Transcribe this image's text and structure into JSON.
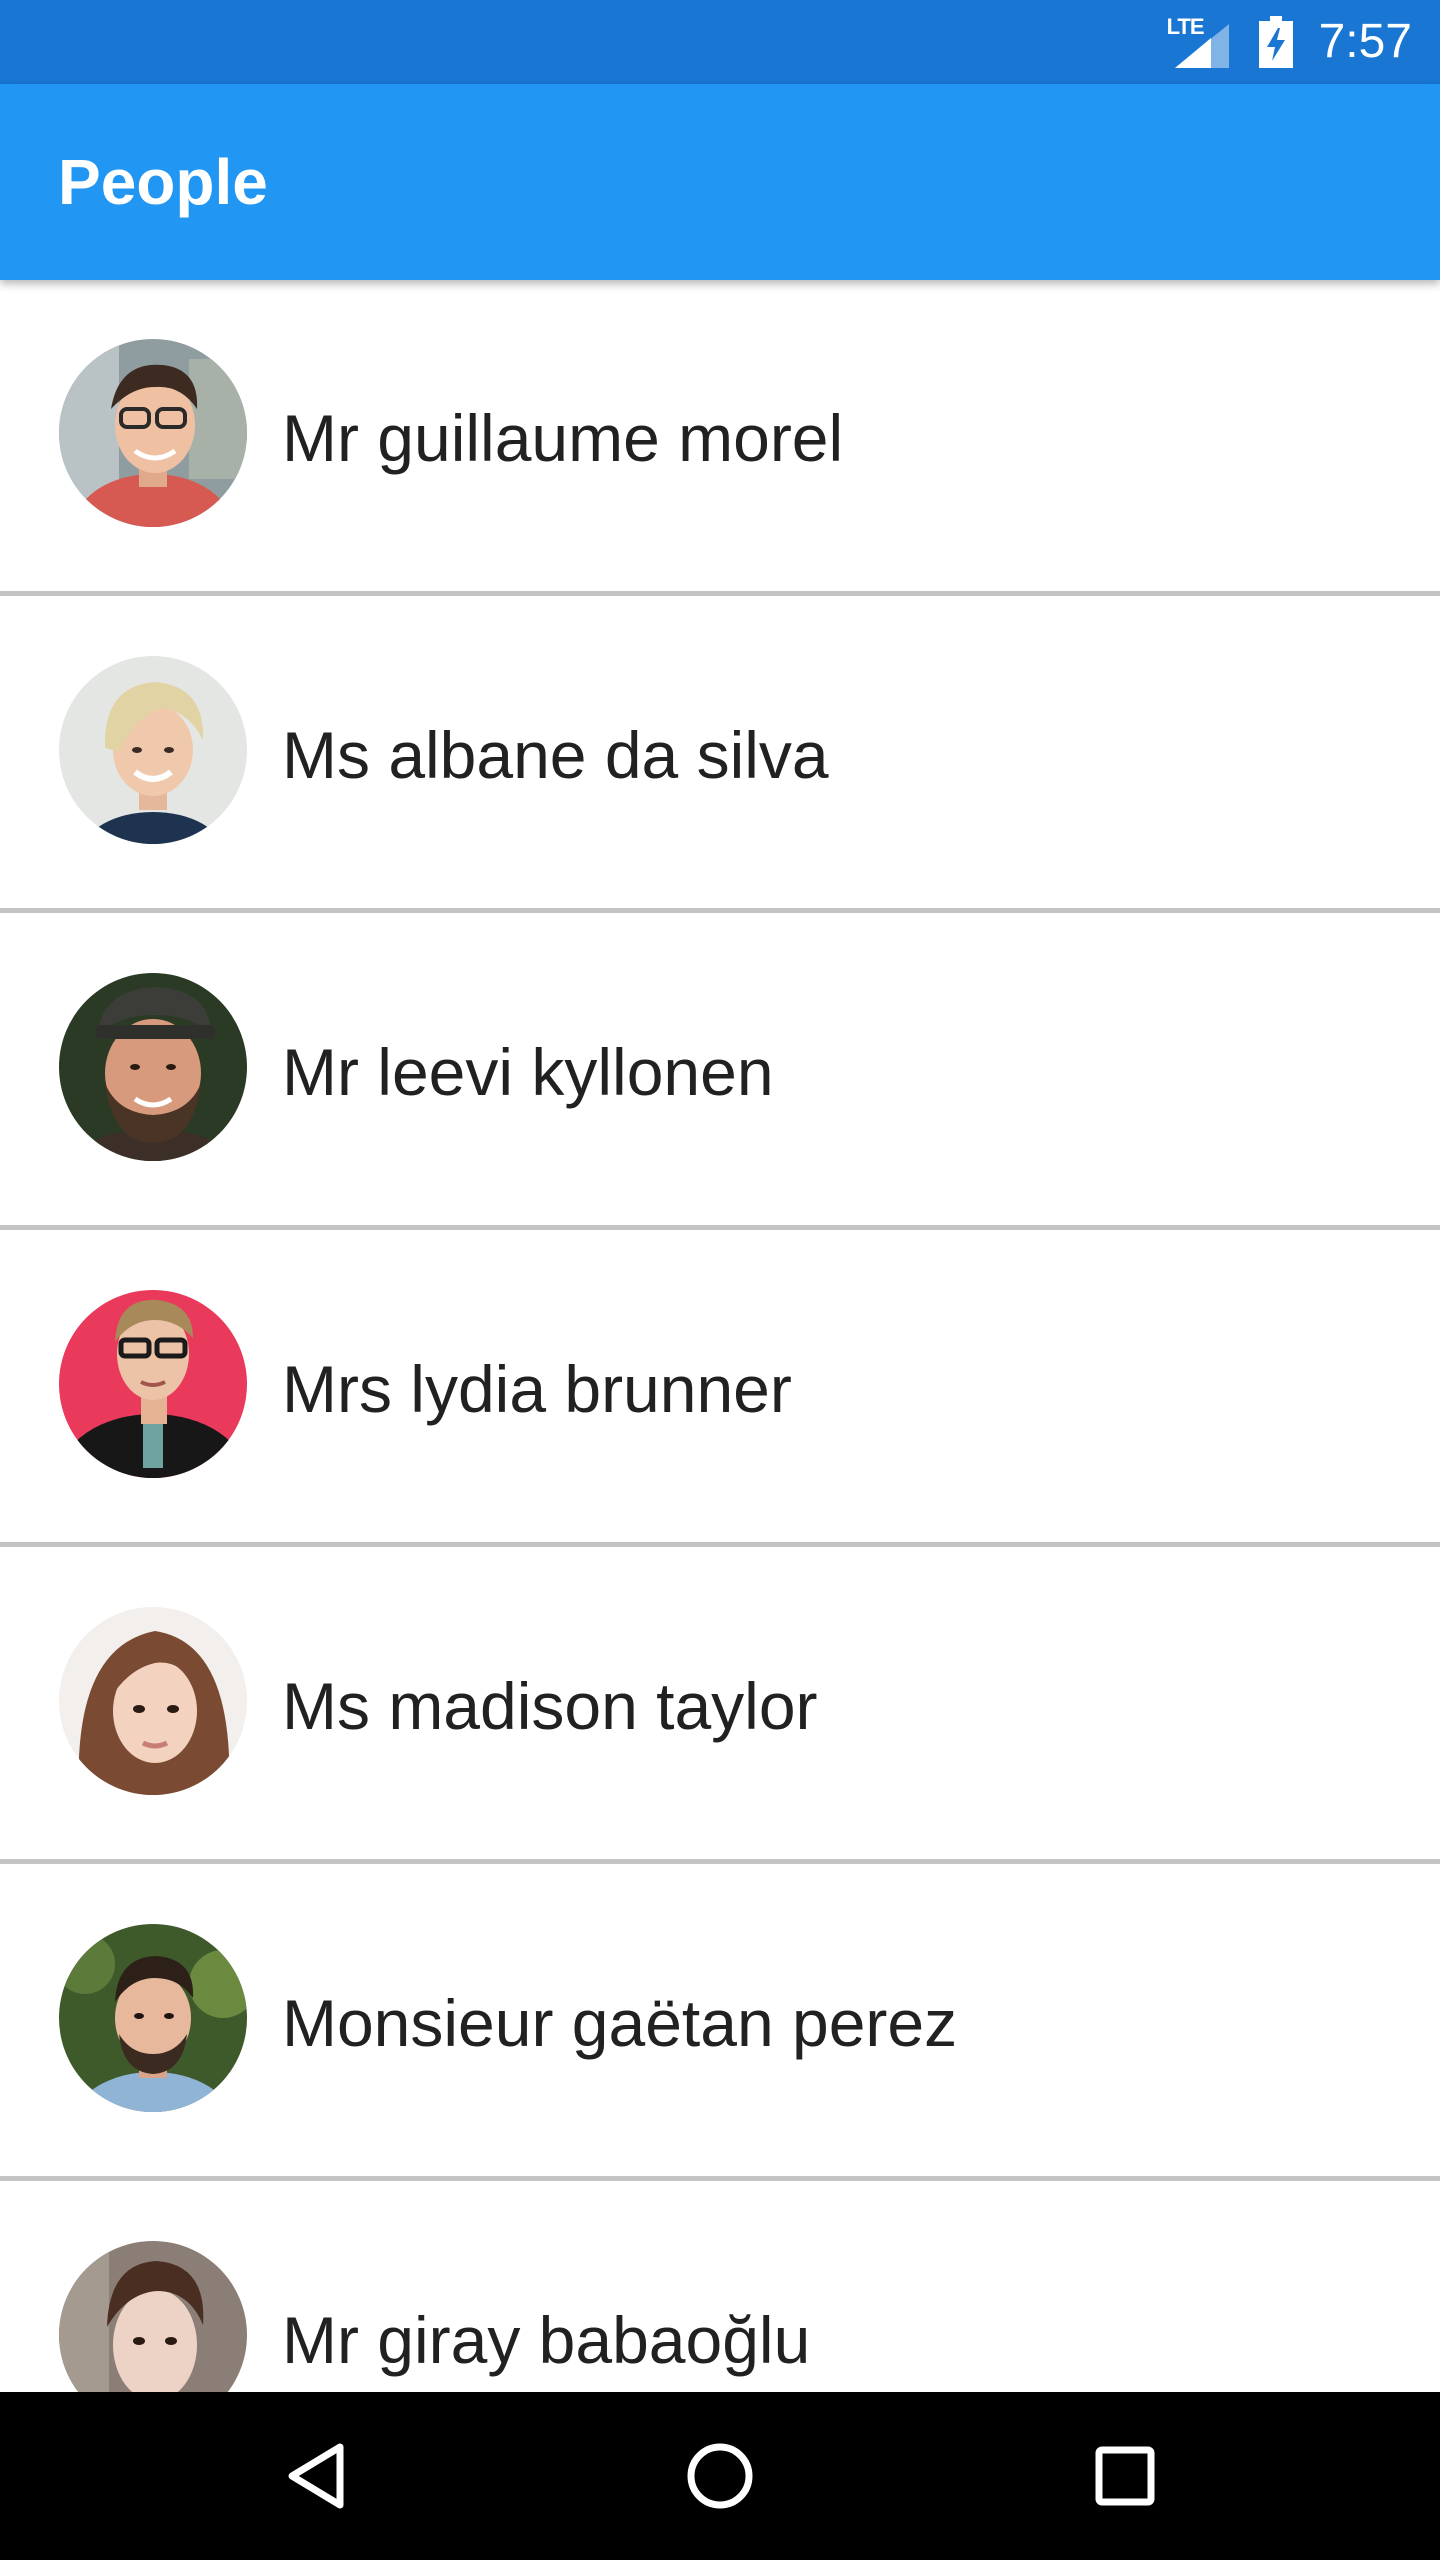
{
  "status_bar": {
    "network_label": "LTE",
    "time": "7:57",
    "icons": [
      "lte-signal-icon",
      "battery-charging-icon"
    ]
  },
  "app_bar": {
    "title": "People"
  },
  "people": [
    {
      "name": "Mr guillaume morel",
      "avatar": "avatar-photo"
    },
    {
      "name": "Ms albane da silva",
      "avatar": "avatar-photo"
    },
    {
      "name": "Mr leevi kyllonen",
      "avatar": "avatar-photo"
    },
    {
      "name": "Mrs lydia brunner",
      "avatar": "avatar-photo"
    },
    {
      "name": "Ms madison taylor",
      "avatar": "avatar-photo"
    },
    {
      "name": "Monsieur gaëtan perez",
      "avatar": "avatar-photo"
    },
    {
      "name": "Mr giray babaoğlu",
      "avatar": "avatar-photo"
    }
  ],
  "nav_bar": {
    "buttons": [
      "back-icon",
      "home-icon",
      "recents-icon"
    ]
  },
  "colors": {
    "status_bar": "#1976D2",
    "app_bar": "#2196F3",
    "text_primary": "#212121",
    "divider": "#c4c4c4",
    "nav_bar": "#000000"
  }
}
